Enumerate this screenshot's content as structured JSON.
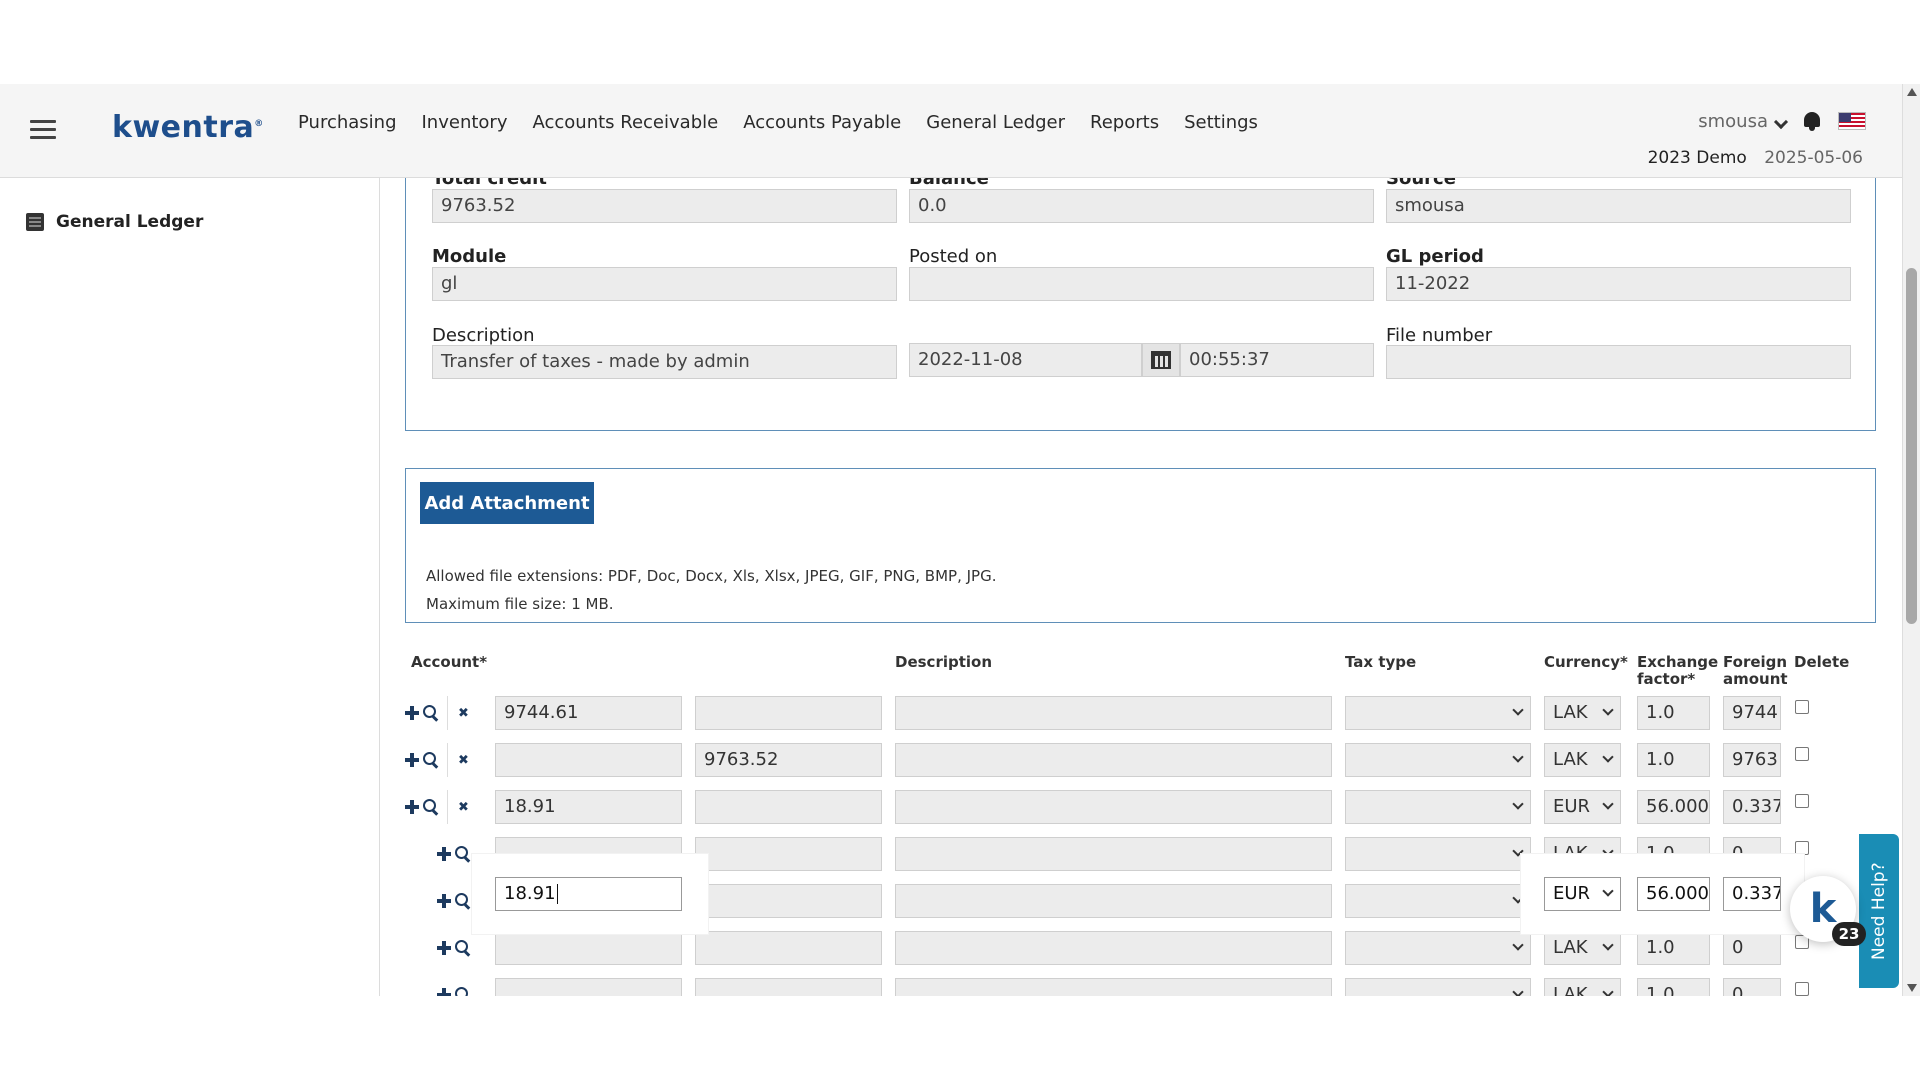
{
  "topbar": {
    "logo": "kwentra",
    "logo_mark": "®",
    "nav": [
      "Purchasing",
      "Inventory",
      "Accounts Receivable",
      "Accounts Payable",
      "General Ledger",
      "Reports",
      "Settings"
    ],
    "user": "smousa",
    "company": "2023 Demo",
    "date": "2025-05-06"
  },
  "sidebar": {
    "item_label": "General Ledger"
  },
  "form": {
    "total_credit_label": "Total credit",
    "total_credit": "9763.52",
    "balance_label": "Balance",
    "balance": "0.0",
    "source_label": "Source",
    "source": "smousa",
    "module_label": "Module",
    "module": "gl",
    "posted_on_label": "Posted on",
    "posted_on": "",
    "gl_period_label": "GL period",
    "gl_period": "11-2022",
    "description_label": "Description",
    "description": "Transfer of taxes - made by admin",
    "date": "2022-11-08",
    "time": "00:55:37",
    "file_number_label": "File number",
    "file_number": ""
  },
  "attachment": {
    "button": "Add Attachment",
    "extensions": "Allowed file extensions: PDF, Doc, Docx, Xls, Xlsx, JPEG, GIF, PNG, BMP, JPG.",
    "max_size": "Maximum file size: 1 MB."
  },
  "grid": {
    "headers": {
      "account": "Account*",
      "description": "Description",
      "tax_type": "Tax type",
      "currency": "Currency*",
      "exchange_1": "Exchange",
      "exchange_2": "factor*",
      "foreign_1": "Foreign",
      "foreign_2": "amount",
      "delete": "Delete"
    },
    "rows": [
      {
        "debit": "9744.61",
        "credit": "",
        "currency": "LAK",
        "factor": "1.0",
        "foreign": "9744"
      },
      {
        "debit": "",
        "credit": "9763.52",
        "currency": "LAK",
        "factor": "1.0",
        "foreign": "9763"
      },
      {
        "debit": "18.91",
        "credit": "",
        "currency": "EUR",
        "factor": "56.000",
        "foreign": "0.337"
      },
      {
        "debit": "",
        "credit": "",
        "currency": "LAK",
        "factor": "1.0",
        "foreign": "0"
      },
      {
        "debit": "",
        "credit": "",
        "currency": "LAK",
        "factor": "1.0",
        "foreign": "0"
      },
      {
        "debit": "",
        "credit": "",
        "currency": "LAK",
        "factor": "1.0",
        "foreign": "0"
      },
      {
        "debit": "",
        "credit": "",
        "currency": "LAK",
        "factor": "1.0",
        "foreign": "0"
      }
    ]
  },
  "help": {
    "label": "Need Help?",
    "badge": "23",
    "bubble_letter": "k"
  },
  "colors": {
    "brand": "#1d5a95",
    "help": "#1a8db5"
  }
}
